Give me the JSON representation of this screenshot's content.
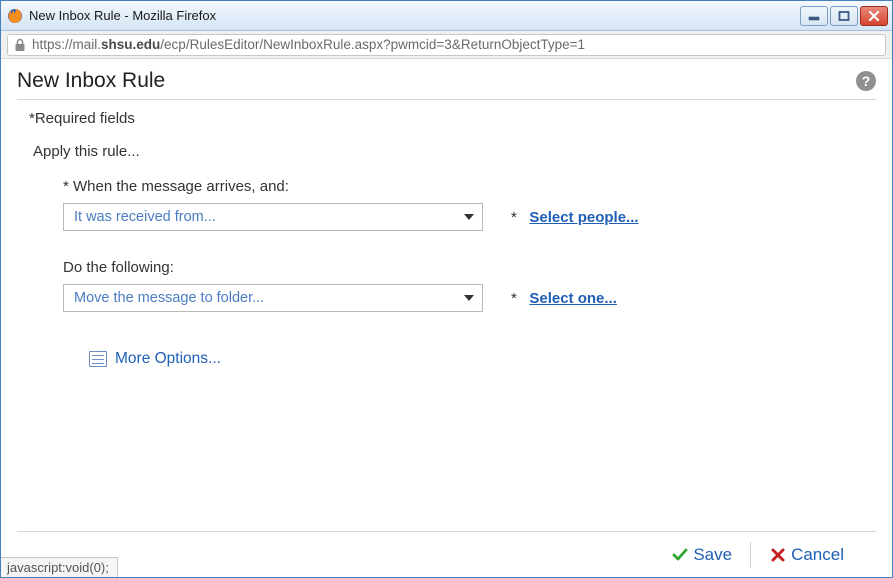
{
  "window": {
    "title": "New Inbox Rule - Mozilla Firefox"
  },
  "url": {
    "prefix": "https://mail.",
    "host": "shsu.edu",
    "path": "/ecp/RulesEditor/NewInboxRule.aspx?pwmcid=3&ReturnObjectType=1"
  },
  "page": {
    "title": "New Inbox Rule",
    "required_label": "*Required fields",
    "apply_label": "Apply this rule..."
  },
  "condition": {
    "label": "* When the message arrives, and:",
    "dropdown_value": "It was received from...",
    "action_prefix": "*",
    "action_link": "Select people..."
  },
  "action": {
    "label": "Do the following:",
    "dropdown_value": "Move the message to folder...",
    "action_prefix": "*",
    "action_link": "Select one..."
  },
  "more_options": "More Options...",
  "buttons": {
    "save": "Save",
    "cancel": "Cancel"
  },
  "status": "javascript:void(0);"
}
